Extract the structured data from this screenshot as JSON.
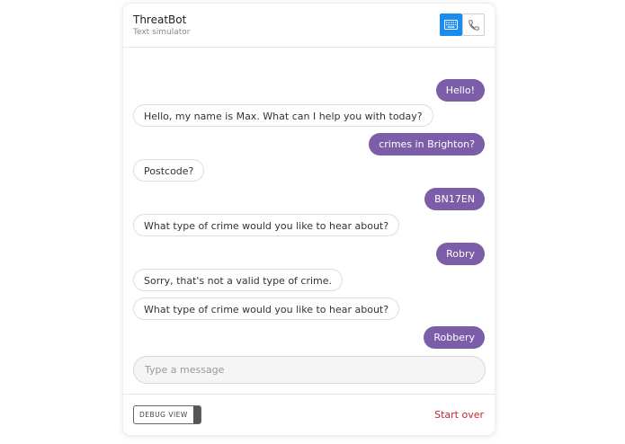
{
  "header": {
    "title": "ThreatBot",
    "subtitle": "Text simulator",
    "keyboard_icon": "keyboard-icon",
    "phone_icon": "phone-icon",
    "active_color": "#1a8cf0"
  },
  "messages": [
    {
      "from": "user",
      "text": "Hello!"
    },
    {
      "from": "bot",
      "text": "Hello, my name is Max. What can I help you with today?"
    },
    {
      "from": "user",
      "text": "crimes in Brighton?"
    },
    {
      "from": "bot",
      "text": "Postcode?"
    },
    {
      "from": "user",
      "text": "BN17EN"
    },
    {
      "from": "bot",
      "text": "What type of crime would you like to hear about?"
    },
    {
      "from": "user",
      "text": "Robry"
    },
    {
      "from": "bot",
      "text": "Sorry, that's not a valid type of crime."
    },
    {
      "from": "bot",
      "text": "What type of crime would you like to hear about?"
    },
    {
      "from": "user",
      "text": "Robbery"
    }
  ],
  "composer": {
    "placeholder": "Type a message",
    "value": ""
  },
  "footer": {
    "debug_label": "DEBUG VIEW",
    "start_over": "Start over"
  },
  "colors": {
    "user_bubble": "#7b5ea7",
    "start_over": "#c0262d"
  }
}
